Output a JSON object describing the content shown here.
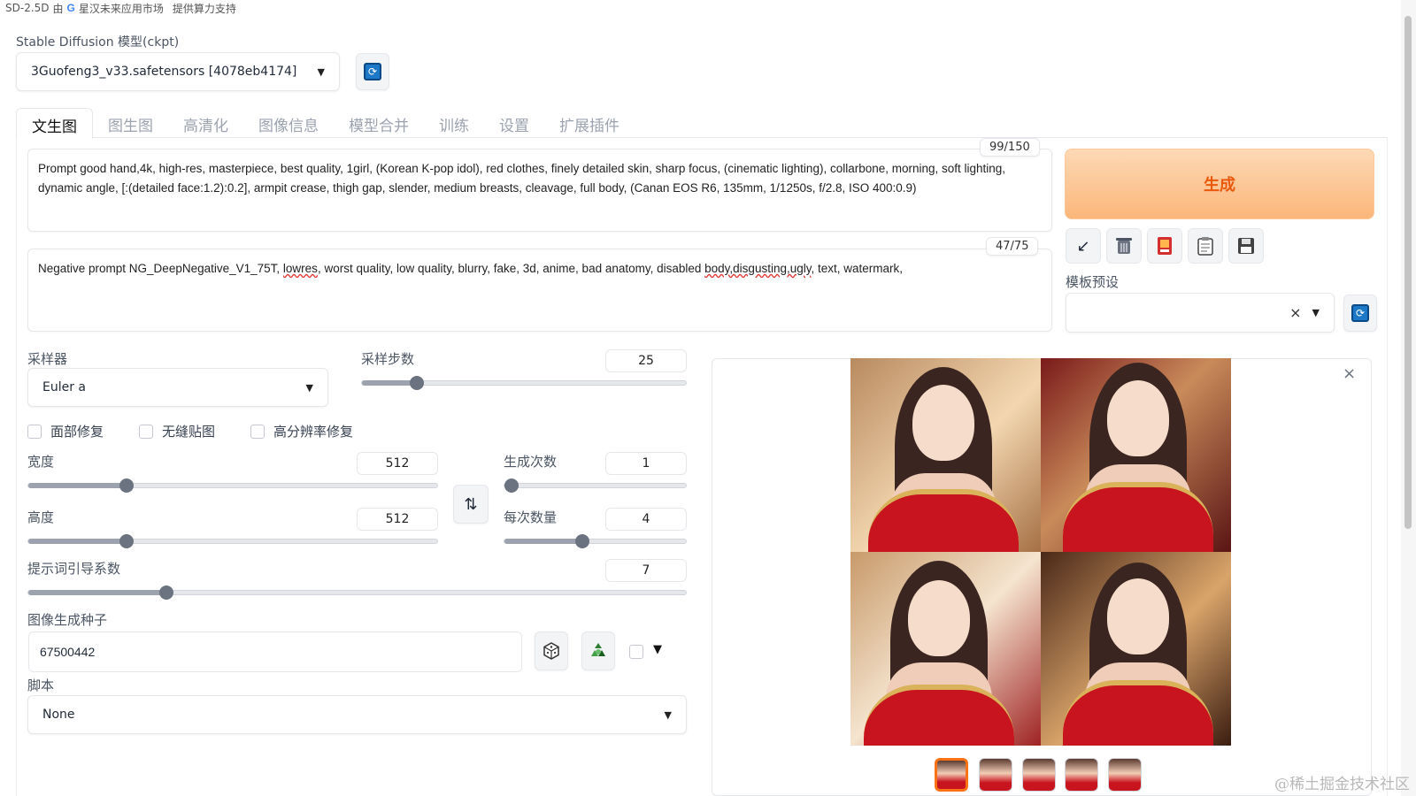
{
  "topbar": {
    "text_a": "SD-2.5D",
    "text_b": "由",
    "g_glyph": "G",
    "text_c": "星汉未来应用市场",
    "text_d": "提供算力支持"
  },
  "model": {
    "label": "Stable Diffusion 模型(ckpt)",
    "value": "3Guofeng3_v33.safetensors [4078eb4174]"
  },
  "tabs": [
    {
      "label": "文生图",
      "active": true
    },
    {
      "label": "图生图"
    },
    {
      "label": "高清化"
    },
    {
      "label": "图像信息"
    },
    {
      "label": "模型合并"
    },
    {
      "label": "训练"
    },
    {
      "label": "设置"
    },
    {
      "label": "扩展插件"
    }
  ],
  "prompt": {
    "counter": "99/150",
    "text": "Prompt good hand,4k, high-res, masterpiece, best quality, 1girl, (Korean K-pop idol), red clothes, finely detailed skin, sharp focus, (cinematic lighting), collarbone, morning, soft lighting, dynamic angle, [:(detailed face:1.2):0.2], armpit crease, thigh gap, slender, medium breasts, cleavage, full body, (Canan EOS R6, 135mm, 1/1250s, f/2.8, ISO 400:0.9)"
  },
  "negative": {
    "counter": "47/75",
    "t1": "Negative prompt NG_DeepNegative_V1_75T, ",
    "t2": "lowres",
    "t3": ", worst quality, low quality, blurry, fake, 3d, anime, bad anatomy, disabled ",
    "t4": "body,disgusting,ugly",
    "t5": ", text, watermark,"
  },
  "generate": {
    "label": "生成"
  },
  "preset": {
    "label": "模板预设",
    "clear_glyph": "×"
  },
  "sampler": {
    "label": "采样器",
    "value": "Euler a"
  },
  "steps": {
    "label": "采样步数",
    "value": "25",
    "fraction": 0.17
  },
  "checkboxes": {
    "face": "面部修复",
    "tiling": "无缝贴图",
    "hires": "高分辨率修复"
  },
  "width": {
    "label": "宽度",
    "value": "512",
    "fraction": 0.24
  },
  "height": {
    "label": "高度",
    "value": "512",
    "fraction": 0.24
  },
  "batch_count": {
    "label": "生成次数",
    "value": "1",
    "fraction": 0.0
  },
  "batch_size": {
    "label": "每次数量",
    "value": "4",
    "fraction": 0.43
  },
  "cfg": {
    "label": "提示词引导系数",
    "value": "7",
    "fraction": 0.21
  },
  "seed": {
    "label": "图像生成种子",
    "value": "67500442",
    "extra_glyph": "▼"
  },
  "script": {
    "label": "脚本",
    "value": "None"
  },
  "gallery": {
    "close_glyph": "×"
  },
  "swap_glyph": "⇅",
  "watermark": "@稀土掘金技术社区"
}
